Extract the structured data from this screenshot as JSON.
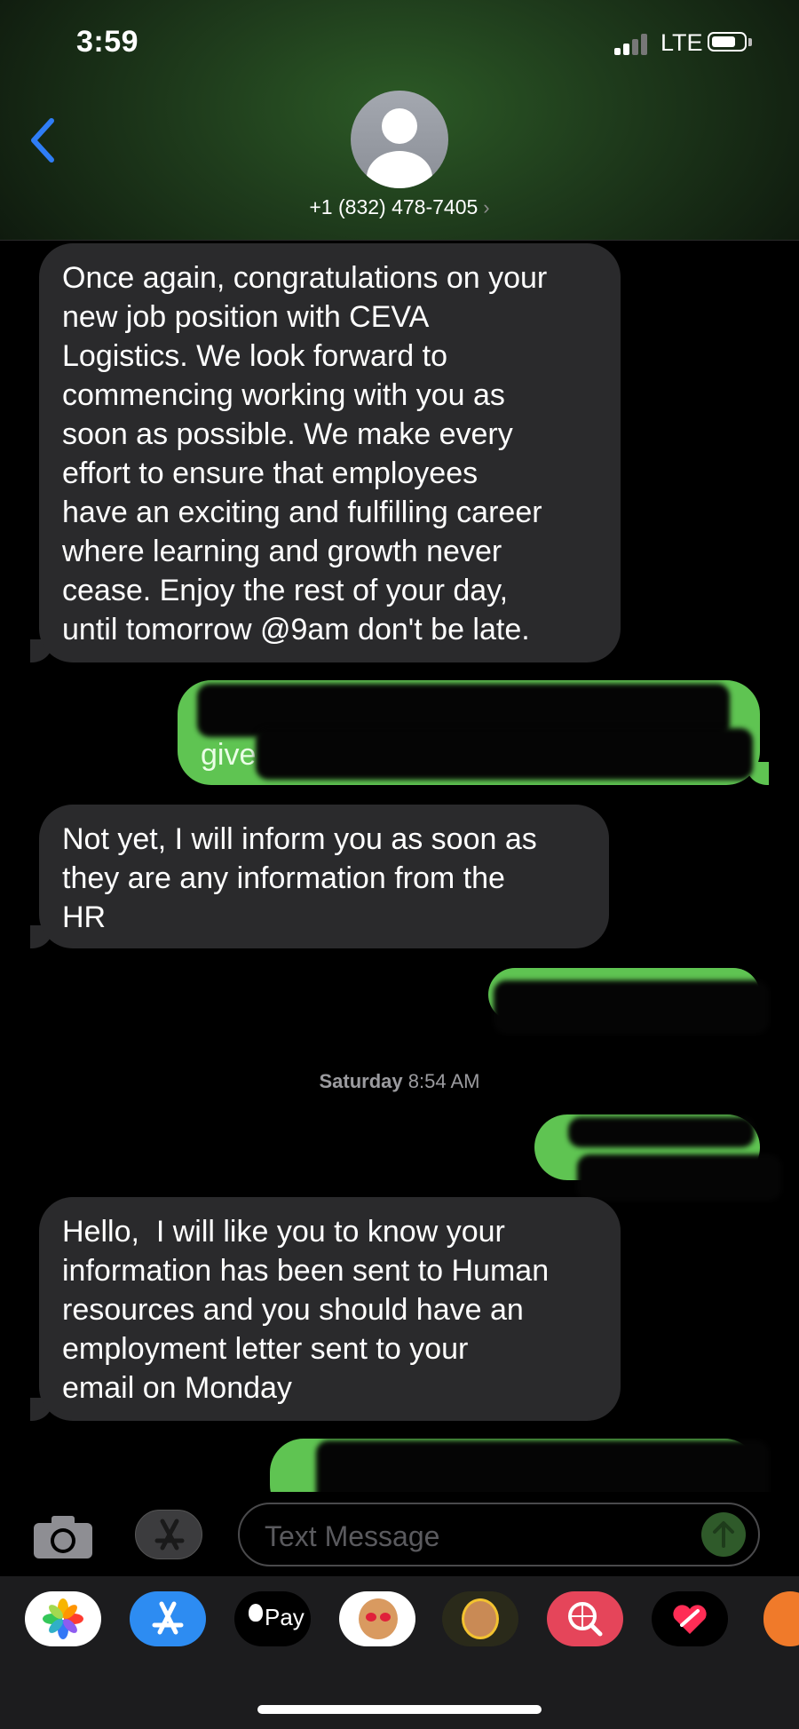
{
  "status_bar": {
    "time": "3:59",
    "network": "LTE"
  },
  "header": {
    "contact": "+1 (832) 478-7405",
    "chevron": "›"
  },
  "messages": {
    "m1": "Once again, congratulations on your\nnew job position with CEVA\nLogistics. We look forward to\ncommencing working with you as\nsoon as possible. We make every\neffort to ensure that employees\nhave an exciting and fulfilling career\nwhere learning and growth never\ncease. Enjoy the rest of your day,\nuntil tomorrow @9am don't be late.",
    "m2_visible": "give",
    "m3": "Not yet, I will inform you as soon as\nthey are any information from the\nHR",
    "m5": "Hello,  I will like you to know your\ninformation has been sent to Human\nresources and you should have an\nemployment letter sent to your\nemail on Monday"
  },
  "timestamp": {
    "day": "Saturday",
    "time": "8:54 AM"
  },
  "compose": {
    "placeholder": "Text Message"
  },
  "app_tray": {
    "items": [
      "photos-icon",
      "app-store-icon",
      "apple-pay-icon",
      "memoji-stickers-icon",
      "memoji-icon",
      "web-search-icon",
      "digital-touch-icon",
      "more-apps-icon"
    ],
    "apple_pay_label": "Pay"
  },
  "colors": {
    "sent": "#5fc452",
    "received": "#2a2a2c",
    "accent": "#2f7df6"
  }
}
